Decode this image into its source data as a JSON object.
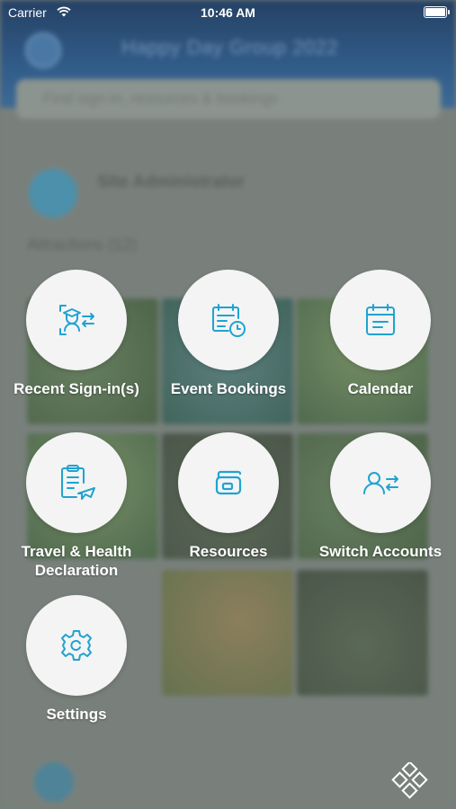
{
  "status_bar": {
    "carrier": "Carrier",
    "time": "10:46 AM"
  },
  "background": {
    "title": "Happy Day Group 2022",
    "search_text": "Find sign-in, resources & bookings",
    "user_name": "Site Administrator",
    "subheading": "Attractions (12)"
  },
  "menu": {
    "items": [
      {
        "label": "Recent Sign-in(s)",
        "icon": "sign-in-user-icon"
      },
      {
        "label": "Event Bookings",
        "icon": "calendar-clock-icon"
      },
      {
        "label": "Calendar",
        "icon": "calendar-icon"
      },
      {
        "label": "Travel & Health Declaration",
        "icon": "clipboard-plane-icon"
      },
      {
        "label": "Resources",
        "icon": "resources-icon"
      },
      {
        "label": "Switch Accounts",
        "icon": "switch-user-icon"
      },
      {
        "label": "Settings",
        "icon": "gear-icon"
      }
    ]
  },
  "colors": {
    "icon_accent": "#1fa3d1",
    "menu_circle": "#f4f4f4",
    "header": "#1b4f86"
  }
}
